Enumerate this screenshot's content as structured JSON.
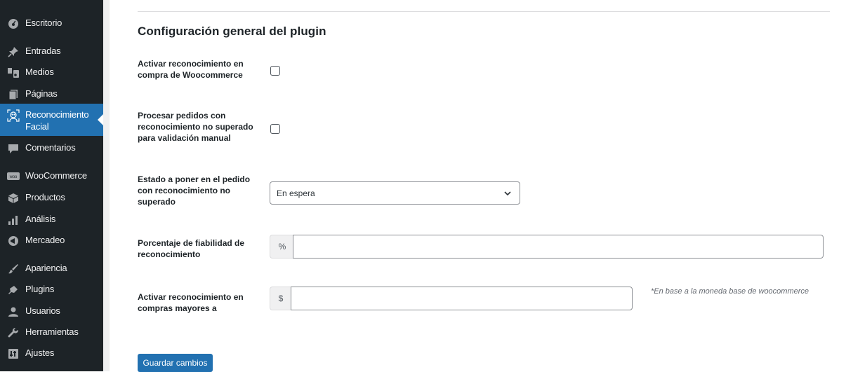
{
  "sidebar": {
    "items": [
      {
        "label": "Escritorio",
        "icon": "dashboard-icon"
      },
      {
        "label": "Entradas",
        "icon": "pushpin-icon"
      },
      {
        "label": "Medios",
        "icon": "media-icon"
      },
      {
        "label": "Páginas",
        "icon": "page-icon"
      },
      {
        "label": "Reconocimiento Facial",
        "icon": "face-recognition-icon",
        "active": true
      },
      {
        "label": "Comentarios",
        "icon": "comment-icon"
      },
      {
        "label": "WooCommerce",
        "icon": "woocommerce-icon"
      },
      {
        "label": "Productos",
        "icon": "product-box-icon"
      },
      {
        "label": "Análisis",
        "icon": "bar-chart-icon"
      },
      {
        "label": "Mercadeo",
        "icon": "megaphone-icon"
      },
      {
        "label": "Apariencia",
        "icon": "paintbrush-icon"
      },
      {
        "label": "Plugins",
        "icon": "plug-icon"
      },
      {
        "label": "Usuarios",
        "icon": "users-icon"
      },
      {
        "label": "Herramientas",
        "icon": "wrench-icon"
      },
      {
        "label": "Ajustes",
        "icon": "settings-icon"
      }
    ],
    "active_color": "#2271b1"
  },
  "main": {
    "title": "Configuración general del plugin",
    "fields": {
      "activate_purchase": {
        "label": "Activar reconocimiento en compra de Woocommerce",
        "checked": false
      },
      "process_orders": {
        "label": "Procesar pedidos con reconocimiento no superado para validación manual",
        "checked": false
      },
      "order_status": {
        "label": "Estado a poner en el pedido con reconocimiento no superado",
        "value": "En espera"
      },
      "reliability": {
        "label": "Porcentaje de fiabilidad de reconocimiento",
        "addon": "%",
        "value": ""
      },
      "min_amount": {
        "label": "Activar reconocimiento en compras mayores a",
        "addon": "$",
        "value": "",
        "hint": "*En base a la moneda base de woocommerce"
      }
    },
    "save_label": "Guardar cambios"
  }
}
